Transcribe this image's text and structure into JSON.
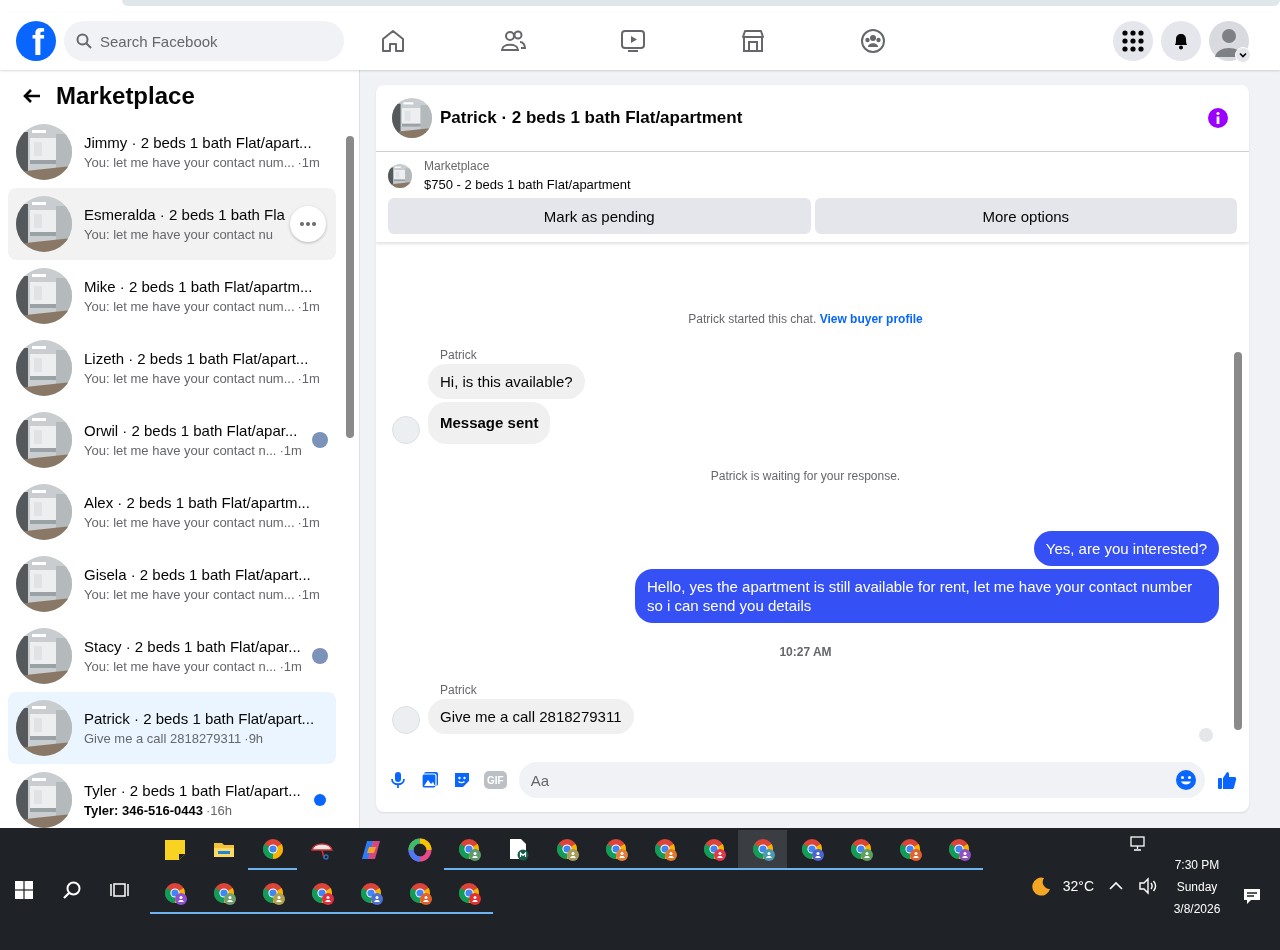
{
  "top_bar": {
    "logo": "f",
    "search": {
      "placeholder": "Search Facebook"
    },
    "nav": [
      {
        "kind": "home"
      },
      {
        "kind": "friends"
      },
      {
        "kind": "video"
      },
      {
        "kind": "marketplace"
      },
      {
        "kind": "groups"
      }
    ],
    "actions": [
      {
        "kind": "menu"
      },
      {
        "kind": "notifications"
      },
      {
        "kind": "account"
      }
    ]
  },
  "sidebar": {
    "title": "Marketplace",
    "conversations": [
      {
        "title": "Jimmy · 2 beds 1 bath Flat/apart...",
        "preview": "You: let me have your contact num...",
        "time": "·1m",
        "selected": false,
        "hovered": false,
        "unread": false,
        "seen": false
      },
      {
        "title": "Esmeralda · 2 beds 1 bath Fla",
        "preview": "You: let me have your contact nu",
        "selected": false,
        "hovered": true,
        "unread": false,
        "seen": false
      },
      {
        "title": "Mike · 2 beds 1 bath Flat/apartm...",
        "preview": "You: let me have your contact num...",
        "time": "·1m",
        "selected": false,
        "hovered": false,
        "unread": false,
        "seen": false
      },
      {
        "title": "Lizeth · 2 beds 1 bath Flat/apart...",
        "preview": "You: let me have your contact num...",
        "time": "·1m",
        "selected": false,
        "hovered": false,
        "unread": false,
        "seen": false
      },
      {
        "title": "Orwil · 2 beds 1 bath Flat/apar...",
        "preview": "You: let me have your contact n...",
        "time": "·1m",
        "selected": false,
        "hovered": false,
        "unread": false,
        "seen": true
      },
      {
        "title": "Alex · 2 beds 1 bath Flat/apartm...",
        "preview": "You: let me have your contact num...",
        "time": "·1m",
        "selected": false,
        "hovered": false,
        "unread": false,
        "seen": false
      },
      {
        "title": "Gisela · 2 beds 1 bath Flat/apart...",
        "preview": "You: let me have your contact num...",
        "time": "·1m",
        "selected": false,
        "hovered": false,
        "unread": false,
        "seen": false
      },
      {
        "title": "Stacy · 2 beds 1 bath Flat/apar...",
        "preview": "You: let me have your contact n...",
        "time": "·1m",
        "selected": false,
        "hovered": false,
        "unread": false,
        "seen": true
      },
      {
        "title": "Patrick · 2 beds 1 bath Flat/apart...",
        "preview": "Give me a call 2818279311",
        "time": "·9h",
        "selected": true,
        "hovered": false,
        "unread": false,
        "seen": false
      },
      {
        "title": "Tyler · 2 beds 1 bath Flat/apart...",
        "preview": "Tyler: 346-516-0443",
        "time": "·16h",
        "selected": false,
        "hovered": false,
        "unread": true,
        "seen": false
      }
    ]
  },
  "chat": {
    "title": "Patrick · 2 beds 1 bath Flat/apartment",
    "listing": {
      "label": "Marketplace",
      "name": "$750 - 2 beds 1 bath Flat/apartment",
      "actions": [
        "Mark as pending",
        "More options"
      ]
    },
    "messages": [
      {
        "kind": "system",
        "text": "Patrick started this chat.",
        "link": "View buyer profile"
      },
      {
        "kind": "incoming",
        "sender": "Patrick",
        "bubbles": [
          {
            "text": "Hi, is this available?",
            "bold": false
          },
          {
            "text": "Message sent",
            "bold": true
          }
        ]
      },
      {
        "kind": "system",
        "text": "Patrick is waiting for your response."
      },
      {
        "kind": "outgoing",
        "bubbles": [
          {
            "text": "Yes, are you interested?",
            "bold": false
          },
          {
            "text": "Hello, yes the apartment is still available for rent, let me have your contact number so i can send you details",
            "bold": false
          }
        ]
      },
      {
        "kind": "time",
        "text": "10:27 AM"
      },
      {
        "kind": "incoming",
        "sender": "Patrick",
        "bubbles": [
          {
            "text": "Give me a call  2818279311",
            "bold": false
          }
        ]
      }
    ],
    "composer": {
      "gif": "GIF",
      "placeholder": "Aa"
    }
  },
  "taskbar": {
    "top_row": [
      {
        "kind": "notes",
        "running": false,
        "selected": false
      },
      {
        "kind": "folder",
        "running": false,
        "selected": false
      },
      {
        "kind": "chrome",
        "running": true,
        "selected": false
      },
      {
        "kind": "snip",
        "running": false,
        "selected": false
      },
      {
        "kind": "copilot",
        "running": false,
        "selected": false
      },
      {
        "kind": "ring",
        "running": false,
        "selected": false
      },
      {
        "kind": "profile",
        "color": "#5c9a6c",
        "running": true,
        "selected": false
      },
      {
        "kind": "doc",
        "running": true,
        "selected": false
      },
      {
        "kind": "profile",
        "color": "#a89c5a",
        "running": true,
        "selected": false
      },
      {
        "kind": "profile",
        "color": "#e0803a",
        "running": true,
        "selected": false
      },
      {
        "kind": "profile",
        "color": "#e07a2a",
        "running": true,
        "selected": false
      },
      {
        "kind": "profile",
        "color": "#e0384c",
        "running": true,
        "selected": false
      },
      {
        "kind": "profile",
        "color": "#4a9ab0",
        "running": true,
        "selected": true
      },
      {
        "kind": "profile",
        "color": "#4a64d0",
        "running": true,
        "selected": false
      },
      {
        "kind": "profile",
        "color": "#5ea060",
        "running": true,
        "selected": false
      },
      {
        "kind": "profile",
        "color": "#e0602e",
        "running": true,
        "selected": false
      },
      {
        "kind": "profile",
        "color": "#9050c0",
        "running": true,
        "selected": false
      }
    ],
    "bottom_row": [
      {
        "kind": "profile",
        "color": "#9050d0",
        "running": true,
        "selected": false
      },
      {
        "kind": "profile",
        "color": "#70a070",
        "running": true,
        "selected": false
      },
      {
        "kind": "profile",
        "color": "#b0a050",
        "running": true,
        "selected": false
      },
      {
        "kind": "profile",
        "color": "#e03040",
        "running": true,
        "selected": false
      },
      {
        "kind": "profile",
        "color": "#5070d0",
        "running": true,
        "selected": false
      },
      {
        "kind": "profile",
        "color": "#e06030",
        "running": true,
        "selected": false
      },
      {
        "kind": "profile",
        "color": "#e03030",
        "running": true,
        "selected": false
      }
    ],
    "weather": "32°C",
    "clock": {
      "time": "7:30 PM",
      "day": "Sunday",
      "date": "3/8/2026"
    }
  }
}
